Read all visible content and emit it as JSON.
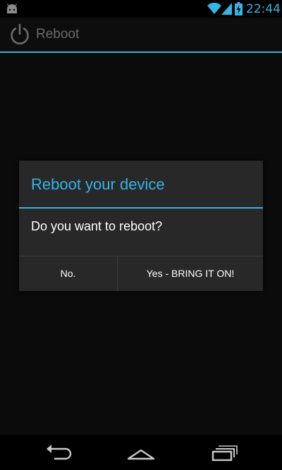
{
  "status_bar": {
    "time": "22:44",
    "icons": [
      "android-icon",
      "wifi-icon",
      "signal-icon",
      "battery-charging-icon"
    ]
  },
  "action_bar": {
    "title": "Reboot",
    "icon": "power-icon"
  },
  "dialog": {
    "title": "Reboot your device",
    "message": "Do you want to reboot?",
    "negative_button": "No.",
    "positive_button": "Yes - BRING IT ON!"
  },
  "nav_bar": {
    "buttons": [
      "back-icon",
      "home-icon",
      "recents-icon"
    ]
  },
  "colors": {
    "accent": "#33b5e5",
    "dialog_bg": "#282828",
    "background": "#000000"
  }
}
